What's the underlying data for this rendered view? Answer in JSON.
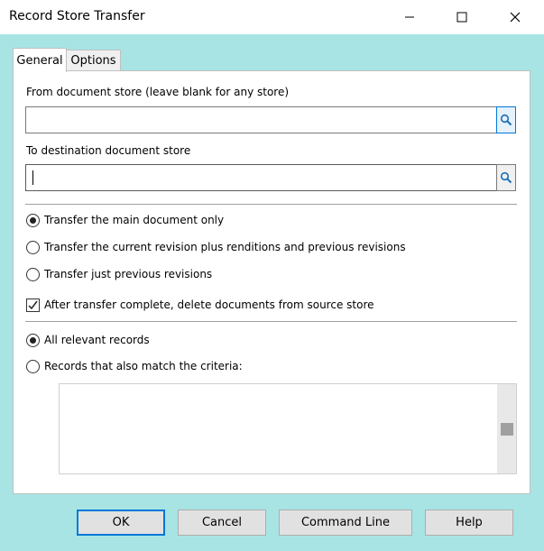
{
  "window": {
    "title": "Record Store Transfer",
    "minimize_icon": "minimize-icon",
    "maximize_icon": "maximize-icon",
    "close_icon": "close-icon"
  },
  "tabs": [
    {
      "label": "General",
      "selected": true
    },
    {
      "label": "Options",
      "selected": false
    }
  ],
  "general": {
    "from_label": "From document store (leave blank for any store)",
    "from_value": "",
    "to_label": "To destination document store",
    "to_value": "",
    "browse_icon": "search-icon",
    "transfer_options": [
      {
        "label": "Transfer the main document only",
        "checked": true
      },
      {
        "label": "Transfer the current revision plus renditions and previous revisions",
        "checked": false
      },
      {
        "label": "Transfer just previous revisions",
        "checked": false
      }
    ],
    "delete_after": {
      "label": "After transfer complete, delete documents from source store",
      "checked": true
    },
    "record_options": [
      {
        "label": "All relevant records",
        "checked": true
      },
      {
        "label": "Records that also match the criteria:",
        "checked": false
      }
    ],
    "criteria_value": ""
  },
  "buttons": {
    "ok": "OK",
    "cancel": "Cancel",
    "command_line": "Command Line",
    "help": "Help"
  },
  "colors": {
    "dialog_background": "#a8e4e4",
    "accent": "#0078d7"
  }
}
